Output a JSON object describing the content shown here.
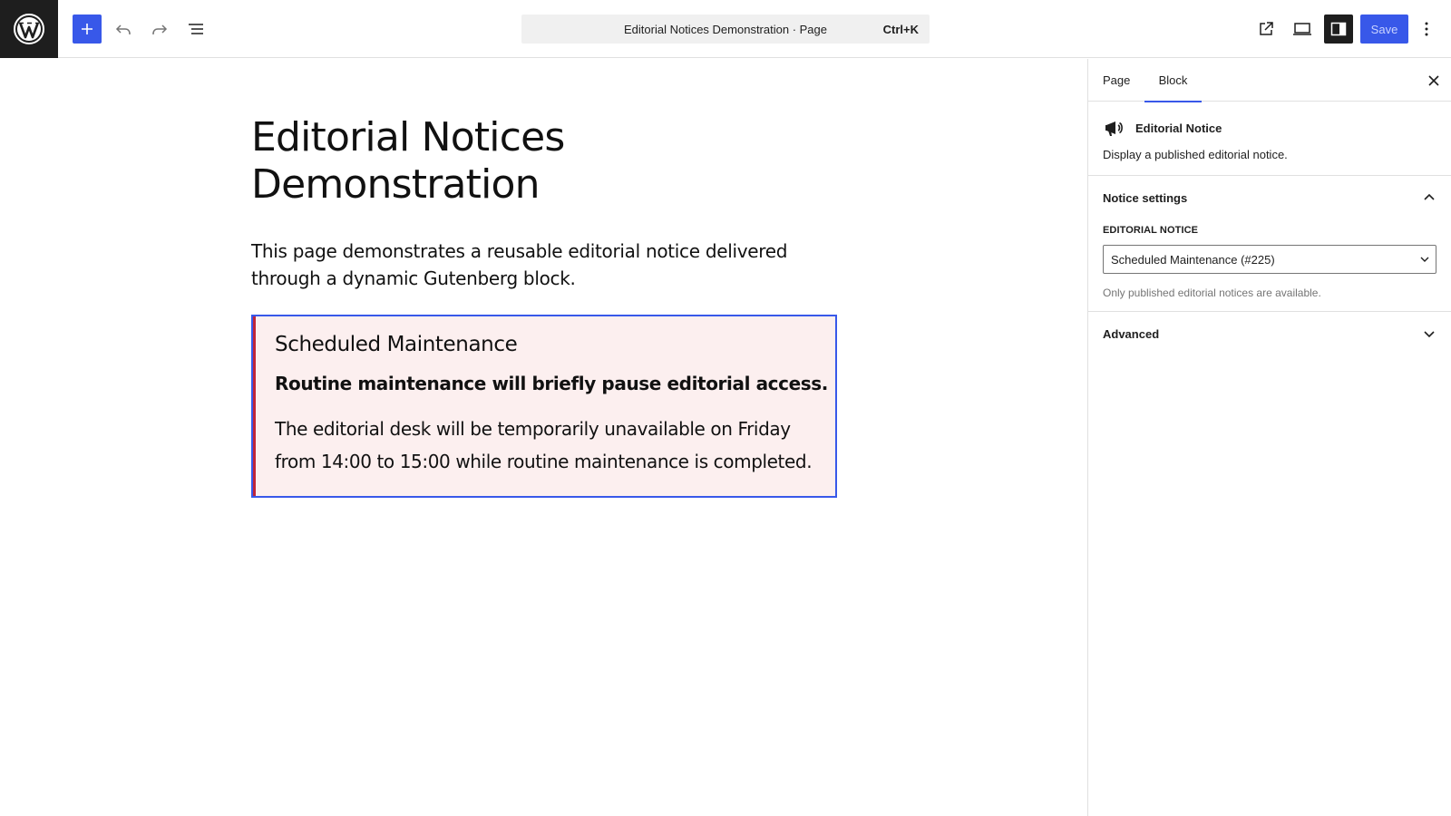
{
  "colors": {
    "accent": "#3858e9",
    "notice_border": "#c0263b",
    "notice_bg": "#fcefef",
    "dark": "#1e1e1e"
  },
  "header": {
    "document_title": "Editorial Notices Demonstration · Page",
    "shortcut": "Ctrl+K",
    "save_label": "Save",
    "icons": [
      "wordpress-icon",
      "plus-icon",
      "undo-icon",
      "redo-icon",
      "list-view-icon",
      "external-link-icon",
      "desktop-preview-icon",
      "sidebar-settings-icon",
      "more-vertical-icon"
    ]
  },
  "content": {
    "title": "Editorial Notices Demonstration",
    "intro": "This page demonstrates a reusable editorial notice delivered through a dynamic Gutenberg block.",
    "notice": {
      "title": "Scheduled Maintenance",
      "summary": "Routine maintenance will briefly pause editorial access.",
      "body": "The editorial desk will be temporarily unavailable on Friday from 14:00 to 15:00 while routine maintenance is completed."
    }
  },
  "sidebar": {
    "tabs": [
      {
        "label": "Page"
      },
      {
        "label": "Block"
      }
    ],
    "active_tab": "Block",
    "block": {
      "name": "Editorial Notice",
      "description": "Display a published editorial notice.",
      "icon": "megaphone-icon"
    },
    "notice_settings": {
      "title": "Notice settings",
      "field_label": "Editorial notice",
      "selected": "Scheduled Maintenance (#225)",
      "help": "Only published editorial notices are available."
    },
    "advanced": {
      "title": "Advanced"
    }
  }
}
